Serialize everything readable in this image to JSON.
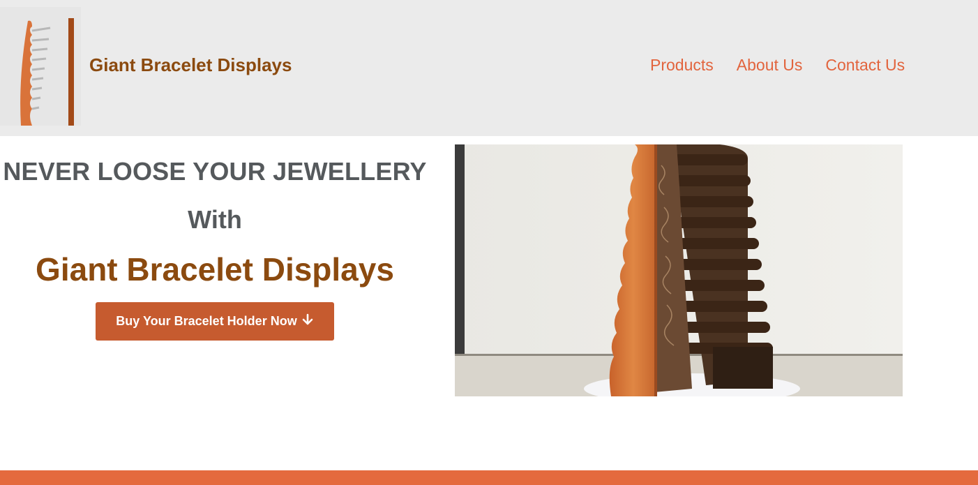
{
  "header": {
    "brand": "Giant Bracelet Displays",
    "logo_icon": "bracelet-stand-logo-icon",
    "nav": [
      {
        "label": "Products"
      },
      {
        "label": "About Us"
      },
      {
        "label": "Contact Us"
      }
    ]
  },
  "hero": {
    "headline": "NEVER LOOSE YOUR JEWELLERY",
    "connector": "With",
    "title": "Giant Bracelet Displays",
    "cta_label": "Buy Your Bracelet Holder Now",
    "cta_icon": "arrow-down-icon",
    "image_subject": "bracelet-stand-photo"
  },
  "colors": {
    "header_bg": "#ebebeb",
    "brand": "#8b4a0f",
    "nav": "#e2643d",
    "headline": "#55595c",
    "cta_bg": "#c65b2f",
    "footer_bar": "#e46a3e"
  }
}
